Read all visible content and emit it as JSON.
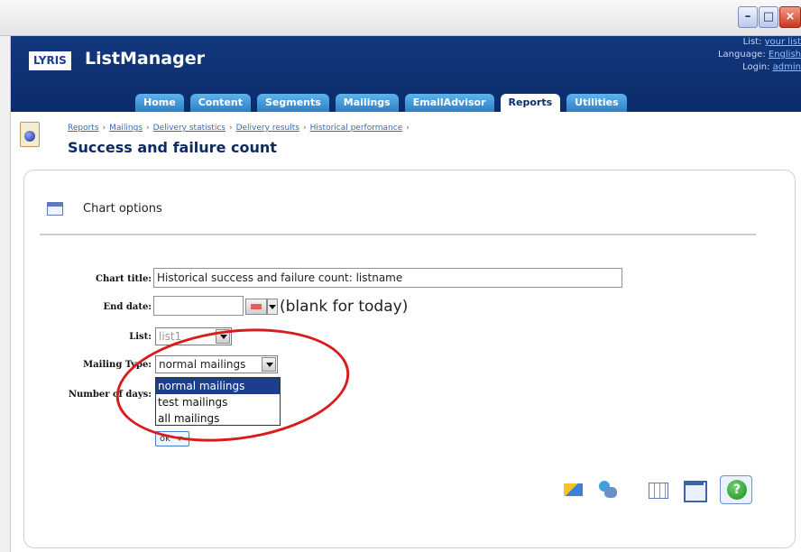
{
  "window": {
    "minimize_icon": "minimize-icon",
    "maximize_icon": "maximize-icon",
    "close_icon": "close-icon"
  },
  "header": {
    "logo": "LYRIS",
    "app_title": "ListManager",
    "list_label": "List:",
    "list_value": "your list",
    "language_label": "Language:",
    "language_value": "English",
    "login_label": "Login:",
    "login_value": "admin"
  },
  "tabs": [
    {
      "label": "Home",
      "active": false
    },
    {
      "label": "Content",
      "active": false
    },
    {
      "label": "Segments",
      "active": false
    },
    {
      "label": "Mailings",
      "active": false
    },
    {
      "label": "EmailAdvisor",
      "active": false
    },
    {
      "label": "Reports",
      "active": true
    },
    {
      "label": "Utilities",
      "active": false
    }
  ],
  "breadcrumb": [
    "Reports",
    "Mailings",
    "Delivery statistics",
    "Delivery results",
    "Historical performance"
  ],
  "page_title": "Success and failure count",
  "panel": {
    "title": "Chart options"
  },
  "form": {
    "chart_title_label": "Chart title:",
    "chart_title_value": "Historical success and failure count: listname",
    "end_date_label": "End date:",
    "end_date_value": "",
    "end_date_hint": "(blank for today)",
    "list_label": "List:",
    "list_value": "list1",
    "mailing_type_label": "Mailing Type:",
    "mailing_type_value": "normal mailings",
    "mailing_type_options": [
      "normal mailings",
      "test mailings",
      "all mailings"
    ],
    "number_of_days_label": "Number of days:",
    "ok_label": "ok"
  },
  "toolbar_icons": [
    "chart-icon",
    "users-icon",
    "table-icon",
    "window-icon",
    "help-icon"
  ],
  "colors": {
    "header_bg": "#0b2c6b",
    "tab_bg": "#3a8fd6",
    "highlight_circle": "#d81c1c",
    "selected_option": "#1c3e8d"
  }
}
